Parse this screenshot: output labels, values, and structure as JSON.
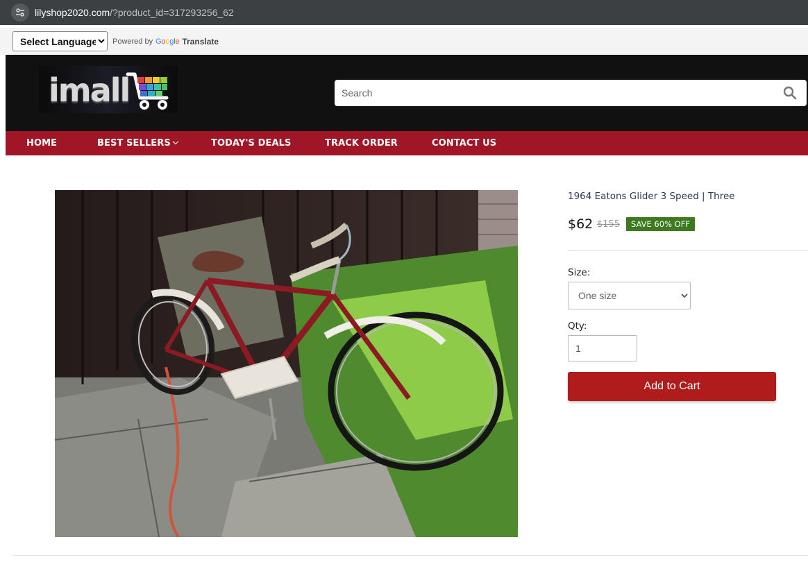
{
  "browser": {
    "url_host": "lilyshop2020.com",
    "url_rest": "/?product_id=317293256_62"
  },
  "translate": {
    "select_label": "Select Language",
    "powered_by": "Powered by",
    "google": [
      "G",
      "o",
      "o",
      "g",
      "l",
      "e"
    ],
    "translate_link": "Translate"
  },
  "header": {
    "logo_text": "imall",
    "search_placeholder": "Search"
  },
  "nav": {
    "items": [
      {
        "label": "HOME"
      },
      {
        "label": "BEST SELLERS"
      },
      {
        "label": "TODAY'S DEALS"
      },
      {
        "label": "TRACK ORDER"
      },
      {
        "label": "CONTACT US"
      }
    ]
  },
  "product": {
    "title": "1964 Eatons Glider 3 Speed | Three",
    "price": "$62",
    "old_price": "$155",
    "save_badge": "SAVE 60% OFF",
    "size_label": "Size:",
    "size_value": "One size",
    "qty_label": "Qty:",
    "qty_value": "1",
    "add_to_cart": "Add to Cart"
  },
  "colors": {
    "header_bg": "#111111",
    "nav_bg": "#a01626",
    "save_badge": "#3d7a1f",
    "add_to_cart": "#b01c1c"
  },
  "icons": [
    "site-settings-icon",
    "search-icon",
    "chevron-down-icon",
    "cart-icon"
  ]
}
